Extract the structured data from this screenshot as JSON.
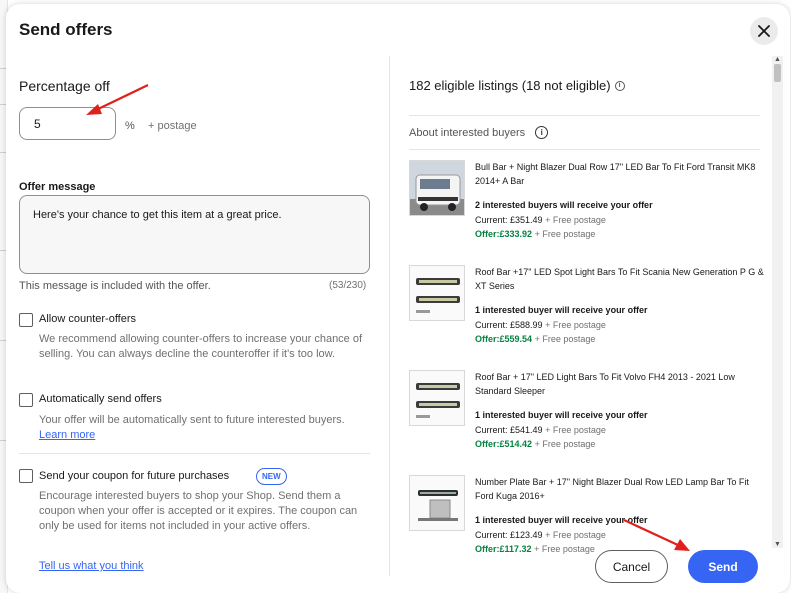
{
  "modal": {
    "title": "Send offers",
    "close_icon": "close-icon"
  },
  "percentage": {
    "label": "Percentage off",
    "value": "5",
    "unit": "%",
    "postage": "+ postage"
  },
  "message": {
    "label": "Offer message",
    "value": "Here's your chance to get this item at a great price.",
    "help": "This message is included with the offer.",
    "count": "(53/230)"
  },
  "options": {
    "counter_offers": {
      "title": "Allow counter-offers",
      "desc": "We recommend allowing counter-offers to increase your chance of selling. You can always decline the counteroffer if it's too low.",
      "checked": false
    },
    "auto_send": {
      "title": "Automatically send offers",
      "desc": "Your offer will be automatically sent to future interested buyers.",
      "link": "Learn more",
      "checked": false
    },
    "coupon": {
      "title": "Send your coupon for future purchases",
      "badge": "NEW",
      "desc": "Encourage interested buyers to shop your Shop. Send them a coupon when your offer is accepted or it expires. The coupon can only be used for items not included in your active offers.",
      "checked": false
    }
  },
  "feedback_link": "Tell us what you think",
  "right": {
    "heading": "182 eligible listings (18 not eligible)",
    "about": "About interested buyers",
    "listings": [
      {
        "title": "Bull Bar + Night Blazer Dual Row 17\" LED Bar To Fit Ford Transit MK8 2014+ A Bar",
        "buyers": "2 interested buyers will receive your offer",
        "current_label": "Current: ",
        "current": "£351.49",
        "current_postage": "+ Free postage",
        "offer_label": "Offer:",
        "offer": "£333.92",
        "offer_postage": "+ Free postage"
      },
      {
        "title": "Roof Bar +17\" LED Spot Light Bars To Fit Scania New Generation P G & XT Series",
        "buyers": "1 interested buyer will receive your offer",
        "current_label": "Current: ",
        "current": "£588.99",
        "current_postage": "+ Free postage",
        "offer_label": "Offer:",
        "offer": "£559.54",
        "offer_postage": "+ Free postage"
      },
      {
        "title": "Roof Bar + 17\" LED Light Bars To Fit Volvo FH4 2013 - 2021 Low Standard Sleeper",
        "buyers": "1 interested buyer will receive your offer",
        "current_label": "Current: ",
        "current": "£541.49",
        "current_postage": "+ Free postage",
        "offer_label": "Offer:",
        "offer": "£514.42",
        "offer_postage": "+ Free postage"
      },
      {
        "title": "Number Plate Bar + 17\" Night Blazer Dual Row LED Lamp Bar To Fit Ford Kuga 2016+",
        "buyers": "1 interested buyer will receive your offer",
        "current_label": "Current: ",
        "current": "£123.49",
        "current_postage": "+ Free postage",
        "offer_label": "Offer:",
        "offer": "£117.32",
        "offer_postage": "+ Free postage"
      }
    ]
  },
  "buttons": {
    "cancel": "Cancel",
    "send": "Send"
  },
  "colors": {
    "accent": "#3665f3",
    "offer_green": "#05823f",
    "annotation_arrow": "#e0201b"
  }
}
